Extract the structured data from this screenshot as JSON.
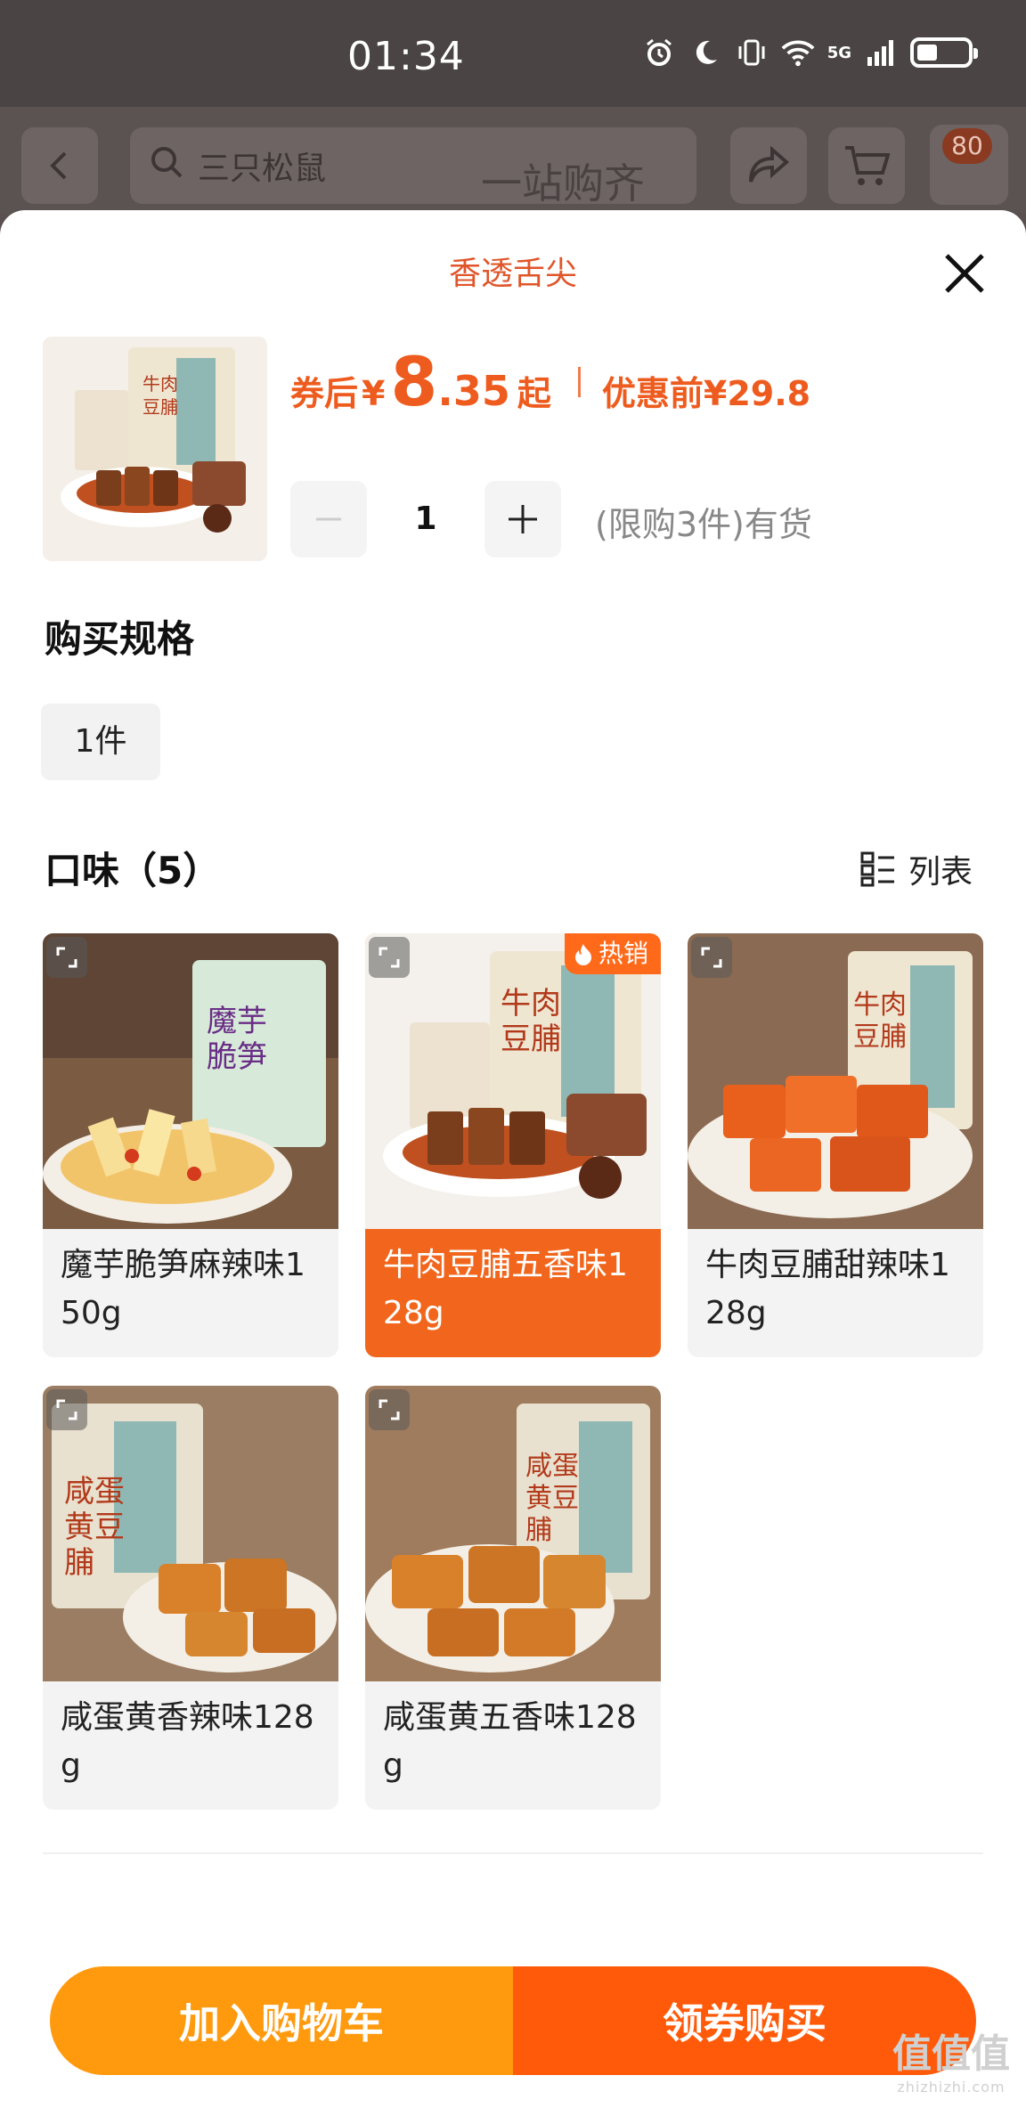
{
  "status_bar": {
    "time": "01:34",
    "network": "5G"
  },
  "background_page": {
    "search_placeholder": "三只松鼠",
    "ghost_text": "一站购齐",
    "cart_count": "80"
  },
  "sheet": {
    "title": "香透舌尖",
    "price": {
      "prefix": "券后",
      "currency": "¥",
      "integer": "8",
      "decimal": ".35",
      "suffix": "起",
      "original_label": "优惠前",
      "original_value": "¥29.8"
    },
    "quantity": "1",
    "stock_text": "(限购3件)有货",
    "spec_section_title": "购买规格",
    "spec_option": "1件",
    "flavor_section_title": "口味（5）",
    "list_toggle_label": "列表",
    "hot_badge": "热销",
    "flavors": [
      {
        "label": "魔芋脆笋麻辣味150g",
        "selected": false
      },
      {
        "label": "牛肉豆脯五香味128g",
        "selected": true
      },
      {
        "label": "牛肉豆脯甜辣味128g",
        "selected": false
      },
      {
        "label": "咸蛋黄香辣味128g",
        "selected": false
      },
      {
        "label": "咸蛋黄五香味128g",
        "selected": false
      }
    ],
    "buttons": {
      "add_to_cart": "加入购物车",
      "buy": "领券购买"
    }
  },
  "watermark": {
    "main": "值值值",
    "sub": "zhizhizhi.com"
  },
  "colors": {
    "accent": "#ee5b1e",
    "cart_button": "#ff9a0e",
    "buy_button": "#ff5a0a",
    "selected_card": "#f1661c"
  }
}
